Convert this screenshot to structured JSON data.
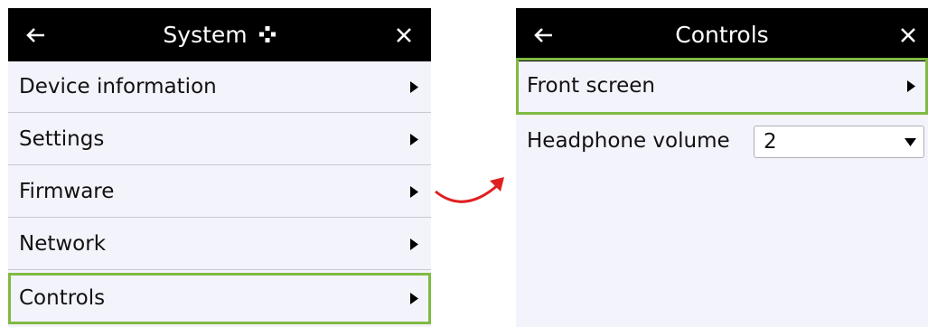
{
  "left": {
    "title": "System",
    "title_icon": "gear-icon",
    "back_icon": "arrow-left-icon",
    "close_icon": "close-icon",
    "items": [
      {
        "label": "Device information"
      },
      {
        "label": "Settings"
      },
      {
        "label": "Firmware"
      },
      {
        "label": "Network"
      },
      {
        "label": "Controls",
        "highlighted": true
      }
    ]
  },
  "right": {
    "title": "Controls",
    "back_icon": "arrow-left-icon",
    "close_icon": "close-icon",
    "items": [
      {
        "label": "Front screen",
        "highlighted": true
      }
    ],
    "settings": [
      {
        "label": "Headphone volume",
        "value": "2"
      }
    ]
  },
  "colors": {
    "titlebar": "#000000",
    "panel_bg": "#f3f3fb",
    "highlight": "#7fba42",
    "transition_arrow": "#e02020"
  },
  "transition_icon": "curved-arrow-icon"
}
